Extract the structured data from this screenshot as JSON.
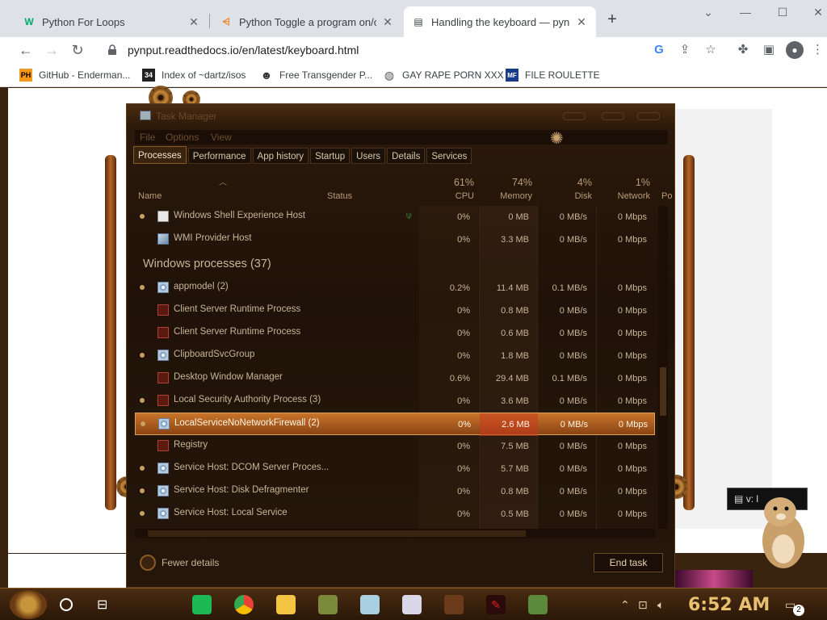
{
  "browser": {
    "tabs": [
      {
        "label": "Python For Loops",
        "icon": "W3",
        "active": false
      },
      {
        "label": "Python Toggle a program on/off",
        "icon": "SO",
        "active": false
      },
      {
        "label": "Handling the keyboard — pynput",
        "icon": "doc",
        "active": true
      }
    ],
    "url": "pynput.readthedocs.io/en/latest/keyboard.html",
    "bookmarks": [
      {
        "label": "GitHub - Enderman...",
        "icon": "PH"
      },
      {
        "label": "Index of ~dartz/isos",
        "icon": "34"
      },
      {
        "label": "Free Transgender P...",
        "icon": "mask"
      },
      {
        "label": "GAY RAPE PORN XXX",
        "icon": "globe"
      },
      {
        "label": "FILE ROULETTE",
        "icon": "MF"
      }
    ]
  },
  "task_manager": {
    "title": "Task Manager",
    "menu": [
      "File",
      "Options",
      "View"
    ],
    "tabs": [
      "Processes",
      "Performance",
      "App history",
      "Startup",
      "Users",
      "Details",
      "Services"
    ],
    "active_tab": "Processes",
    "columns": {
      "name": "Name",
      "status": "Status",
      "cpu": {
        "label": "CPU",
        "pct": "61%"
      },
      "memory": {
        "label": "Memory",
        "pct": "74%"
      },
      "disk": {
        "label": "Disk",
        "pct": "4%"
      },
      "network": {
        "label": "Network",
        "pct": "1%"
      },
      "power": "Po"
    },
    "rows_top": [
      {
        "name": "Windows Shell Experience Host",
        "cpu": "0%",
        "memory": "0 MB",
        "disk": "0 MB/s",
        "network": "0 Mbps"
      },
      {
        "name": "WMI Provider Host",
        "cpu": "0%",
        "memory": "3.3 MB",
        "disk": "0 MB/s",
        "network": "0 Mbps"
      }
    ],
    "group_header": "Windows processes (37)",
    "rows": [
      {
        "name": "appmodel (2)",
        "cpu": "0.2%",
        "memory": "11.4 MB",
        "disk": "0.1 MB/s",
        "network": "0 Mbps"
      },
      {
        "name": "Client Server Runtime Process",
        "cpu": "0%",
        "memory": "0.8 MB",
        "disk": "0 MB/s",
        "network": "0 Mbps"
      },
      {
        "name": "Client Server Runtime Process",
        "cpu": "0%",
        "memory": "0.6 MB",
        "disk": "0 MB/s",
        "network": "0 Mbps"
      },
      {
        "name": "ClipboardSvcGroup",
        "cpu": "0%",
        "memory": "1.8 MB",
        "disk": "0 MB/s",
        "network": "0 Mbps"
      },
      {
        "name": "Desktop Window Manager",
        "cpu": "0.6%",
        "memory": "29.4 MB",
        "disk": "0.1 MB/s",
        "network": "0 Mbps"
      },
      {
        "name": "Local Security Authority Process (3)",
        "cpu": "0%",
        "memory": "3.6 MB",
        "disk": "0 MB/s",
        "network": "0 Mbps"
      },
      {
        "name": "LocalServiceNoNetworkFirewall (2)",
        "cpu": "0%",
        "memory": "2.6 MB",
        "disk": "0 MB/s",
        "network": "0 Mbps"
      },
      {
        "name": "Registry",
        "cpu": "0%",
        "memory": "7.5 MB",
        "disk": "0 MB/s",
        "network": "0 Mbps"
      },
      {
        "name": "Service Host: DCOM Server Proces...",
        "cpu": "0%",
        "memory": "5.7 MB",
        "disk": "0 MB/s",
        "network": "0 Mbps"
      },
      {
        "name": "Service Host: Disk Defragmenter",
        "cpu": "0%",
        "memory": "0.8 MB",
        "disk": "0 MB/s",
        "network": "0 Mbps"
      },
      {
        "name": "Service Host: Local Service",
        "cpu": "0%",
        "memory": "0.5 MB",
        "disk": "0 MB/s",
        "network": "0 Mbps"
      }
    ],
    "footer": {
      "fewer_details": "Fewer details",
      "end_task": "End task"
    }
  },
  "mascot_label": "v: l",
  "taskbar": {
    "clock": "6:52 AM",
    "notification_count": "2"
  }
}
